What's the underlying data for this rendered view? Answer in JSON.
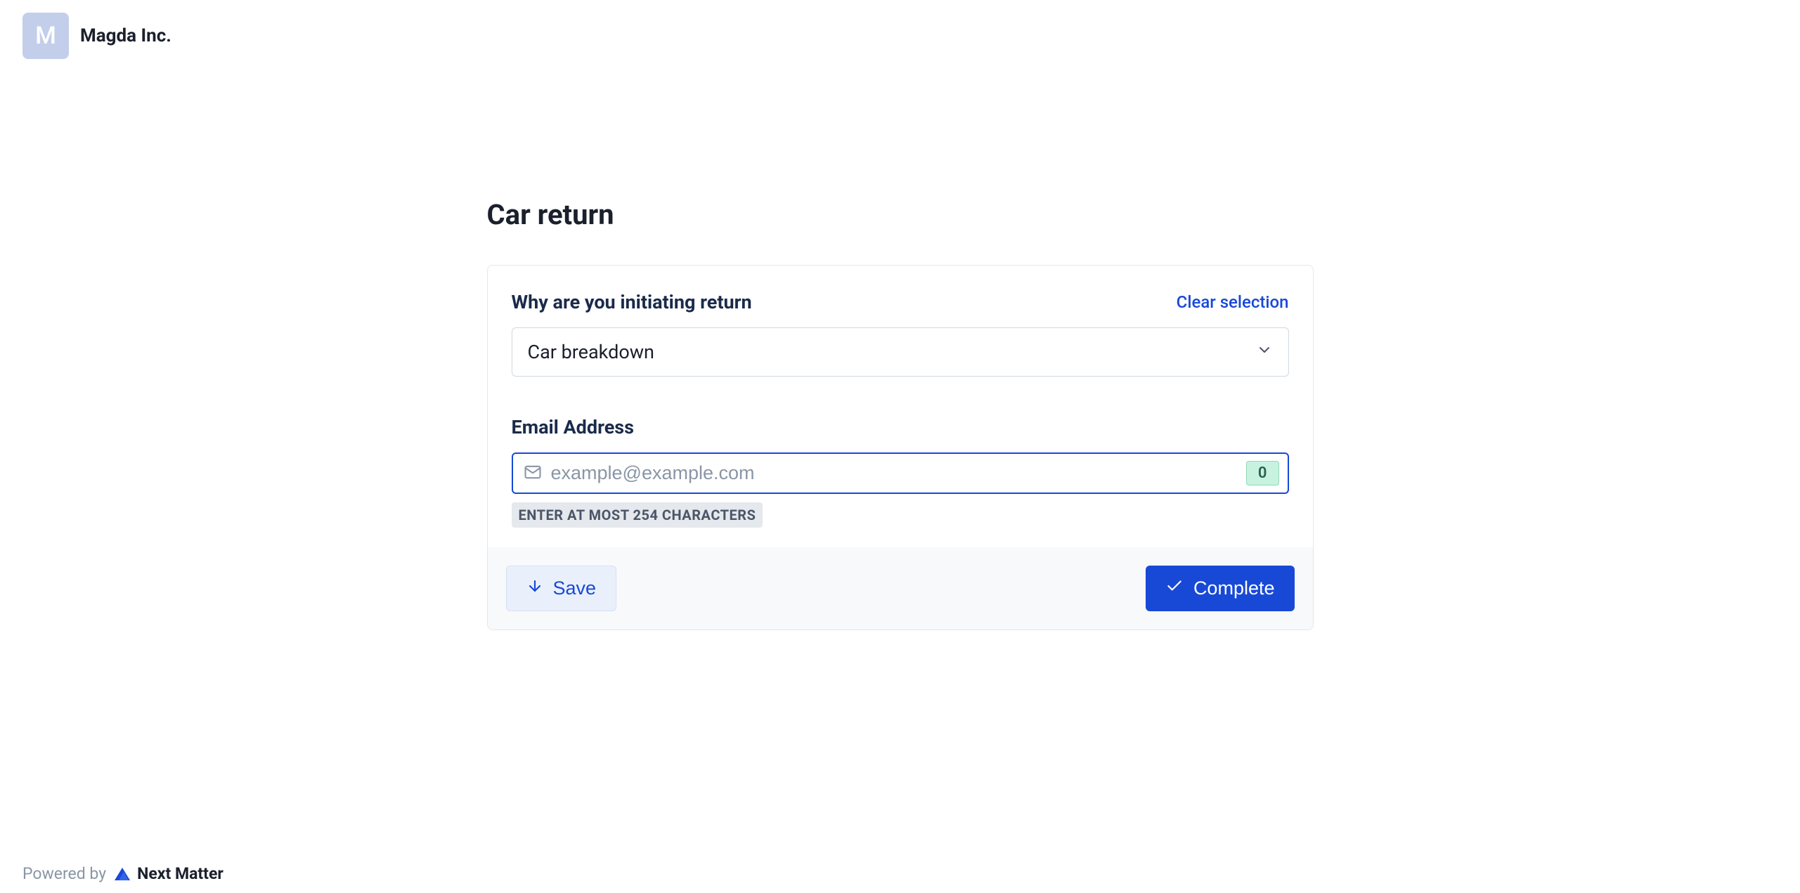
{
  "header": {
    "logo_letter": "M",
    "company_name": "Magda Inc."
  },
  "form": {
    "title": "Car return",
    "field_reason": {
      "label": "Why are you initiating return",
      "clear_label": "Clear selection",
      "selected_value": "Car breakdown"
    },
    "field_email": {
      "label": "Email Address",
      "placeholder": "example@example.com",
      "value": "",
      "char_count": "0",
      "helper_text": "ENTER AT MOST 254 CHARACTERS"
    },
    "actions": {
      "save_label": "Save",
      "complete_label": "Complete"
    }
  },
  "footer": {
    "powered_by_label": "Powered by",
    "brand_name": "Next Matter"
  }
}
